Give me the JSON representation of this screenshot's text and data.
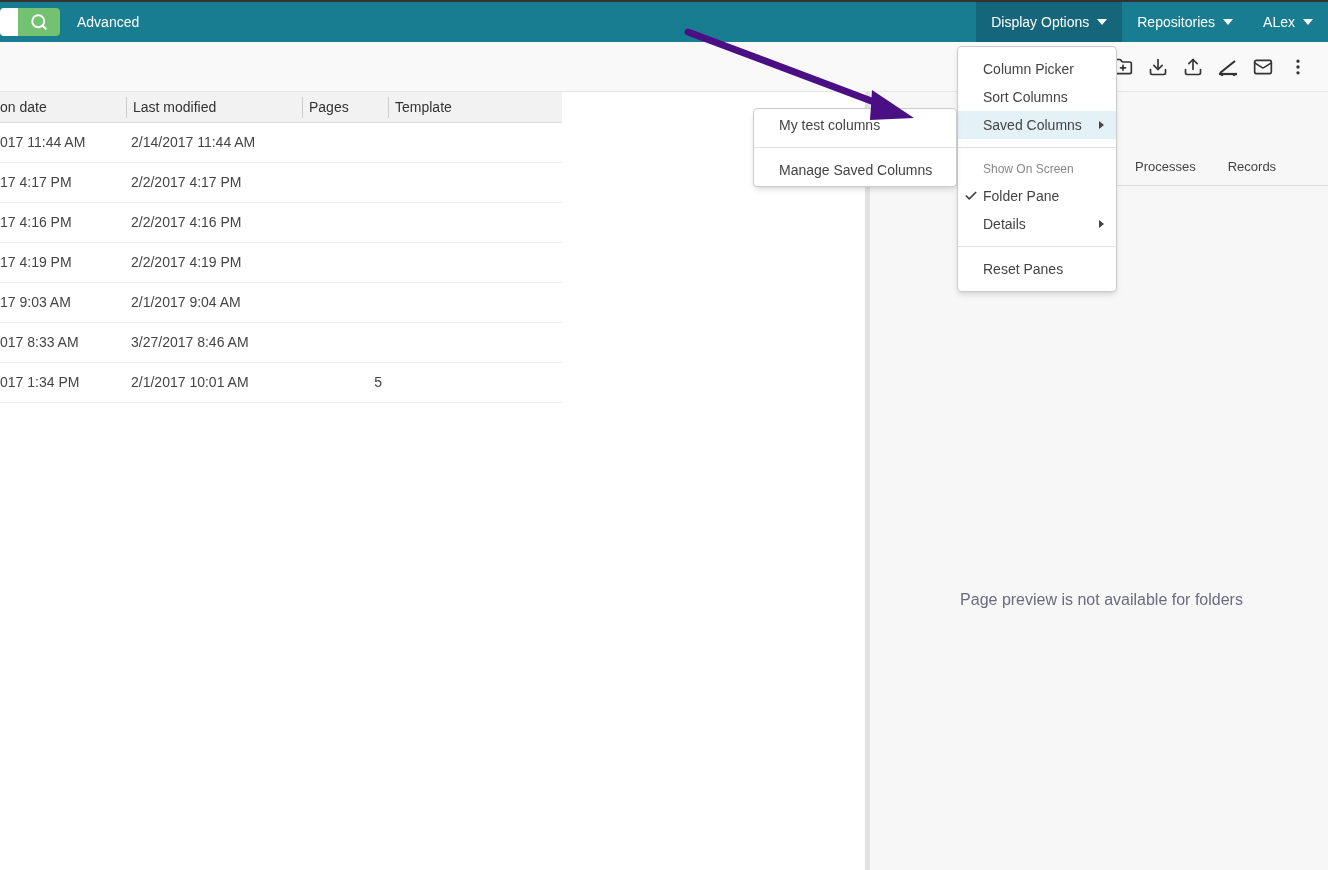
{
  "topbar": {
    "advanced_link": "Advanced",
    "nav": [
      {
        "label": "Display Options",
        "selected": true
      },
      {
        "label": "Repositories",
        "selected": false
      },
      {
        "label": "ALex",
        "selected": false
      }
    ]
  },
  "table": {
    "columns": [
      "on date",
      "Last modified",
      "Pages",
      "Template"
    ],
    "rows": [
      [
        "017 11:44 AM",
        "2/14/2017 11:44 AM",
        "",
        ""
      ],
      [
        "17 4:17 PM",
        "2/2/2017 4:17 PM",
        "",
        ""
      ],
      [
        "17 4:16 PM",
        "2/2/2017 4:16 PM",
        "",
        ""
      ],
      [
        "17 4:19 PM",
        "2/2/2017 4:19 PM",
        "",
        ""
      ],
      [
        "17 9:03 AM",
        "2/1/2017 9:04 AM",
        "",
        ""
      ],
      [
        "017 8:33 AM",
        "3/27/2017 8:46 AM",
        "",
        ""
      ],
      [
        "017 1:34 PM",
        "2/1/2017 10:01 AM",
        "5",
        ""
      ]
    ]
  },
  "preview": {
    "tabs": [
      "Processes",
      "Records"
    ],
    "message": "Page preview is not available for folders"
  },
  "display_menu": [
    {
      "kind": "item",
      "label": "Column Picker",
      "checked": false,
      "submenu": false,
      "selected": false
    },
    {
      "kind": "item",
      "label": "Sort Columns",
      "checked": false,
      "submenu": false,
      "selected": false
    },
    {
      "kind": "item",
      "label": "Saved Columns",
      "checked": false,
      "submenu": true,
      "selected": true
    },
    {
      "kind": "divider"
    },
    {
      "kind": "header",
      "label": "Show On Screen"
    },
    {
      "kind": "item",
      "label": "Folder Pane",
      "checked": true,
      "submenu": false,
      "selected": false
    },
    {
      "kind": "item",
      "label": "Details",
      "checked": false,
      "submenu": true,
      "selected": false
    },
    {
      "kind": "divider"
    },
    {
      "kind": "item",
      "label": "Reset Panes",
      "checked": false,
      "submenu": false,
      "selected": false
    }
  ],
  "saved_columns_menu": [
    {
      "kind": "item",
      "label": "My test columns"
    },
    {
      "kind": "divider"
    },
    {
      "kind": "item",
      "label": "Manage Saved Columns"
    }
  ]
}
